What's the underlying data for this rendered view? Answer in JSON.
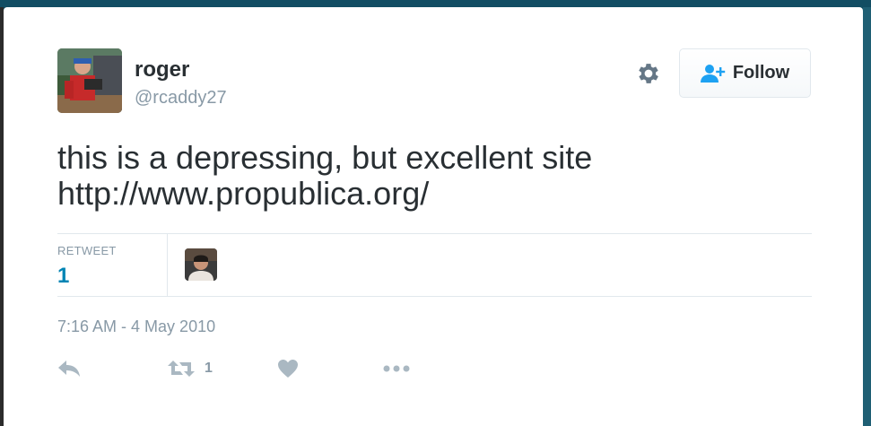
{
  "user": {
    "name": "roger",
    "handle": "@rcaddy27"
  },
  "header": {
    "follow_label": "Follow"
  },
  "tweet": {
    "text_line1": "this is a depressing, but excellent site",
    "text_line2": "http://www.propublica.org/",
    "timestamp": "7:16 AM - 4 May 2010"
  },
  "stats": {
    "retweet_label": "RETWEET",
    "retweet_count": "1"
  },
  "actions": {
    "retweet_count": "1"
  },
  "icons": [
    "gear-icon",
    "follow-user-icon",
    "reply-icon",
    "retweet-icon",
    "heart-icon",
    "more-icon"
  ],
  "colors": {
    "link": "#0084b4",
    "muted": "#8899a6",
    "text": "#292f33",
    "border": "#e1e8ed"
  }
}
